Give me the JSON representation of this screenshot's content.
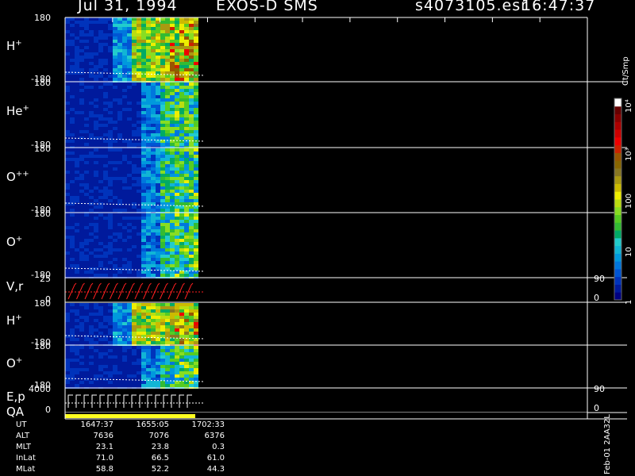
{
  "header": {
    "date": "Jul 31, 1994",
    "instrument": "EXOS-D SMS",
    "file": "s4073105.esr",
    "time": "16:47:37"
  },
  "panels": [
    {
      "id": "h1",
      "label": "H",
      "sup": "+",
      "top_tick": "180",
      "bottom_tick": "-180"
    },
    {
      "id": "he",
      "label": "He",
      "sup": "+",
      "top_tick": "180",
      "bottom_tick": "-180"
    },
    {
      "id": "opp",
      "label": "O",
      "sup": "++",
      "top_tick": "180",
      "bottom_tick": "-180"
    },
    {
      "id": "o1",
      "label": "O",
      "sup": "+",
      "top_tick": "180",
      "bottom_tick": "-180"
    },
    {
      "id": "vr",
      "label": "V,r",
      "sup": "",
      "top_tick": "25",
      "bottom_tick": "0",
      "right_top": "90",
      "right_bottom": "0"
    },
    {
      "id": "h2",
      "label": "H",
      "sup": "+",
      "top_tick": "180",
      "bottom_tick": "-180"
    },
    {
      "id": "o2",
      "label": "O",
      "sup": "+",
      "top_tick": "180",
      "bottom_tick": "-180"
    },
    {
      "id": "ep",
      "label": "E,p",
      "sup": "",
      "top_tick": "4000",
      "bottom_tick": "0",
      "right_top": "90",
      "right_bottom": "0"
    },
    {
      "id": "qa",
      "label": "QA",
      "sup": "",
      "top_tick": "",
      "bottom_tick": ""
    }
  ],
  "colorbar": {
    "unit": "Ct/Smp",
    "labels": [
      {
        "text": "1",
        "value": 1
      },
      {
        "text": "10",
        "value": 10
      },
      {
        "text": "100",
        "value": 100
      },
      {
        "text": "10³",
        "value": 1000
      },
      {
        "text": "10⁴",
        "value": 10000
      }
    ],
    "colors": [
      "#000080",
      "#001a9c",
      "#0033bb",
      "#0055d4",
      "#0077dd",
      "#0099dd",
      "#11b5d5",
      "#22cccc",
      "#00aa66",
      "#33bb33",
      "#55cc22",
      "#88dd22",
      "#bbdd11",
      "#eeee00",
      "#ccbb00",
      "#aa9911",
      "#887722",
      "#886600",
      "#995500",
      "#cc2200",
      "#ee0000",
      "#cc0000",
      "#aa0000",
      "#880000",
      "#660000",
      "#ffffff"
    ]
  },
  "footer": {
    "rows": [
      {
        "label": "UT",
        "values": [
          "1647:37",
          "1655:05",
          "1702:33"
        ]
      },
      {
        "label": "ALT",
        "values": [
          "7636",
          "7076",
          "6376"
        ]
      },
      {
        "label": "MLT",
        "values": [
          "23.1",
          "23.8",
          "0.3"
        ]
      },
      {
        "label": "InLat",
        "values": [
          "71.0",
          "66.5",
          "61.0"
        ]
      },
      {
        "label": "MLat",
        "values": [
          "58.8",
          "52.2",
          "44.3"
        ]
      }
    ],
    "side_note": "Feb-01 2AA32L"
  },
  "chart_data": {
    "type": "heatmap",
    "title": "Jul 31, 1994   EXOS-D SMS",
    "xlabel": "UT",
    "x_ticks": [
      "1647:37",
      "1655:05",
      "1702:33"
    ],
    "data_extent_note": "data present only from 1647:37 to about 1655",
    "panels": [
      {
        "name": "H+",
        "ylim": [
          -180,
          180
        ]
      },
      {
        "name": "He+",
        "ylim": [
          -180,
          180
        ]
      },
      {
        "name": "O++",
        "ylim": [
          -180,
          180
        ]
      },
      {
        "name": "O+",
        "ylim": [
          -180,
          180
        ]
      },
      {
        "name": "V,r",
        "ylim": [
          0,
          25
        ],
        "right_ylim": [
          0,
          90
        ]
      },
      {
        "name": "H+",
        "ylim": [
          -180,
          180
        ]
      },
      {
        "name": "O+",
        "ylim": [
          -180,
          180
        ]
      },
      {
        "name": "E,p",
        "ylim": [
          0,
          4000
        ],
        "right_ylim": [
          0,
          90
        ]
      }
    ],
    "colorbar_scale": "log",
    "colorbar_range": [
      1,
      10000
    ],
    "colorbar_unit": "Ct/Smp"
  }
}
